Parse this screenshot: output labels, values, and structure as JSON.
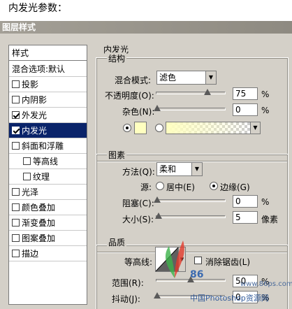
{
  "caption": "内发光参数：",
  "dialog": {
    "title": "图层样式"
  },
  "style_list": {
    "header": "样式",
    "blend_options": "混合选项:默认",
    "items": [
      {
        "label": "投影",
        "checked": false,
        "selected": false,
        "sub": false
      },
      {
        "label": "内阴影",
        "checked": false,
        "selected": false,
        "sub": false
      },
      {
        "label": "外发光",
        "checked": true,
        "selected": false,
        "sub": false
      },
      {
        "label": "内发光",
        "checked": true,
        "selected": true,
        "sub": false
      },
      {
        "label": "斜面和浮雕",
        "checked": false,
        "selected": false,
        "sub": false
      },
      {
        "label": "等高线",
        "checked": false,
        "selected": false,
        "sub": true
      },
      {
        "label": "纹理",
        "checked": false,
        "selected": false,
        "sub": true
      },
      {
        "label": "光泽",
        "checked": false,
        "selected": false,
        "sub": false
      },
      {
        "label": "颜色叠加",
        "checked": false,
        "selected": false,
        "sub": false
      },
      {
        "label": "渐变叠加",
        "checked": false,
        "selected": false,
        "sub": false
      },
      {
        "label": "图案叠加",
        "checked": false,
        "selected": false,
        "sub": false
      },
      {
        "label": "描边",
        "checked": false,
        "selected": false,
        "sub": false
      }
    ]
  },
  "panel": {
    "title": "内发光",
    "structure": {
      "title": "结构",
      "blend_mode_label": "混合模式:",
      "blend_mode_value": "滤色",
      "opacity_label": "不透明度(O):",
      "opacity_value": "75",
      "opacity_unit": "%",
      "opacity_fraction": 0.75,
      "noise_label": "杂色(N):",
      "noise_value": "0",
      "noise_unit": "%",
      "noise_fraction": 0,
      "glow_color": "#ffffc0"
    },
    "elements": {
      "title": "图素",
      "technique_label": "方法(Q):",
      "technique_value": "柔和",
      "source_label": "源:",
      "source_center": "居中(E)",
      "source_edge": "边缘(G)",
      "source_selected": "edge",
      "choke_label": "阻塞(C):",
      "choke_value": "0",
      "choke_unit": "%",
      "choke_fraction": 0,
      "size_label": "大小(S):",
      "size_value": "5",
      "size_unit": "像素",
      "size_fraction": 0.02
    },
    "quality": {
      "title": "品质",
      "contour_label": "等高线:",
      "antialias_label": "消除锯齿(L)",
      "antialias_checked": false,
      "range_label": "范围(R):",
      "range_value": "50",
      "range_unit": "%",
      "range_fraction": 0.5,
      "jitter_label": "抖动(J):",
      "jitter_value": "0",
      "jitter_unit": "%",
      "jitter_fraction": 0
    }
  },
  "watermark": {
    "logo": "86",
    "url": "www.86ps.com",
    "text": "中国Photoshop资源网"
  }
}
